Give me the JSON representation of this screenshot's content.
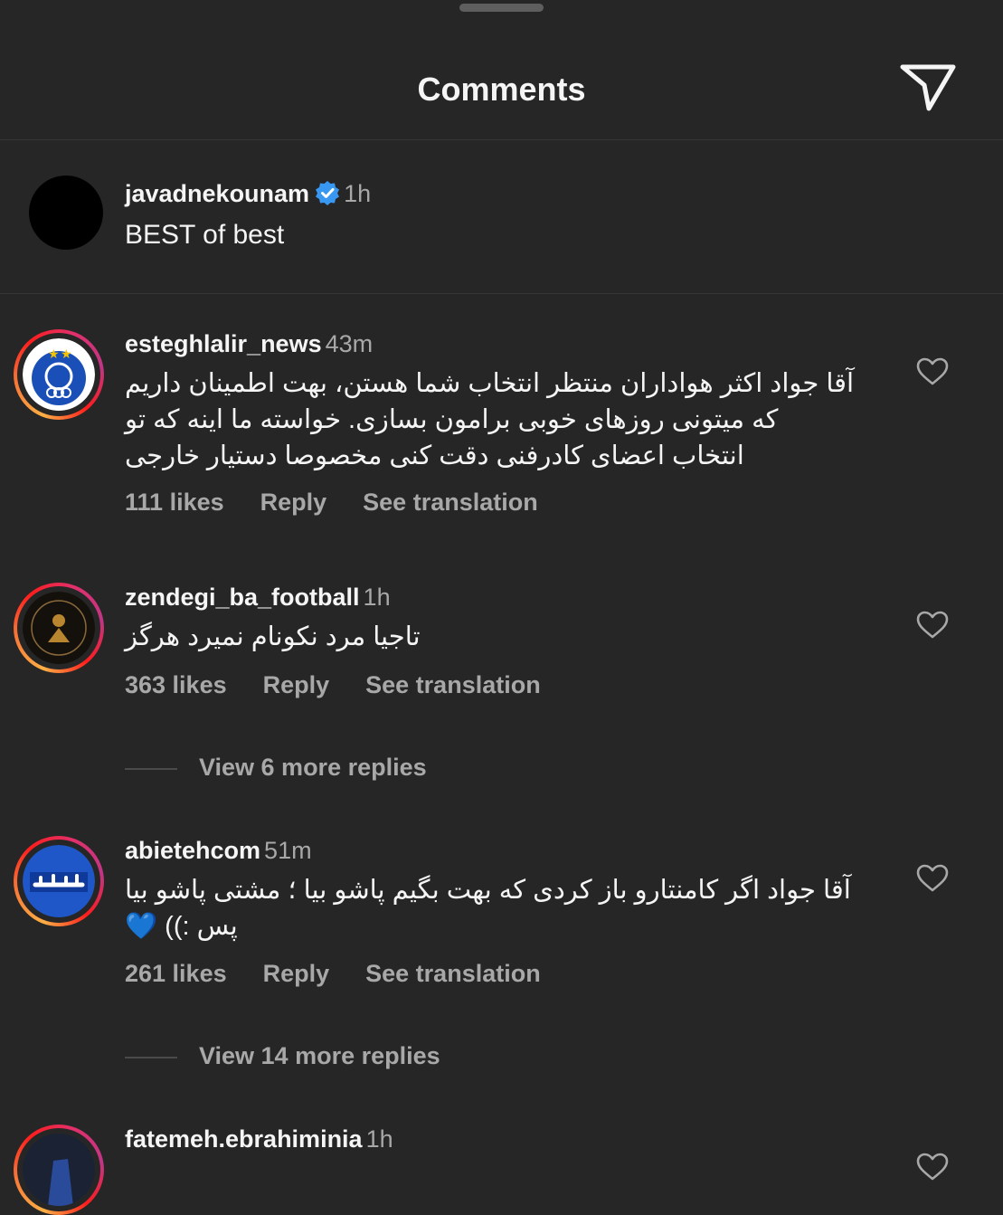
{
  "header": {
    "title": "Comments",
    "send_icon": "paper-plane-icon"
  },
  "caption": {
    "username": "javadnekounam",
    "verified": true,
    "time": "1h",
    "text": "BEST of best"
  },
  "comments": [
    {
      "username": "esteghlalir_news",
      "time": "43m",
      "text": "آقا جواد اکثر هواداران منتظر انتخاب شما هستن، بهت اطمینان داریم که میتونی روزهای خوبی برامون بسازی. خواسته ما اینه که تو انتخاب اعضای کادرفنی دقت کنی مخصوصا دستیار خارجی",
      "likes": "111 likes",
      "reply": "Reply",
      "translate": "See translation"
    },
    {
      "username": "zendegi_ba_football",
      "time": "1h",
      "text": "تاجیا مرد نکونام نمیرد هرگز",
      "likes": "363 likes",
      "reply": "Reply",
      "translate": "See translation",
      "more_replies": "View 6 more replies"
    },
    {
      "username": "abietehcom",
      "time": "51m",
      "text": "آقا جواد اگر کامنتارو باز کردی که بهت بگیم پاشو بیا ؛ مشتی پاشو بیا پس :)) 💙",
      "likes": "261 likes",
      "reply": "Reply",
      "translate": "See translation",
      "more_replies": "View 14 more replies"
    },
    {
      "username": "fatemeh.ebrahiminia",
      "time": "1h"
    }
  ],
  "colors": {
    "background": "#262626",
    "muted": "#a8a8a8",
    "verified": "#3897f0"
  }
}
